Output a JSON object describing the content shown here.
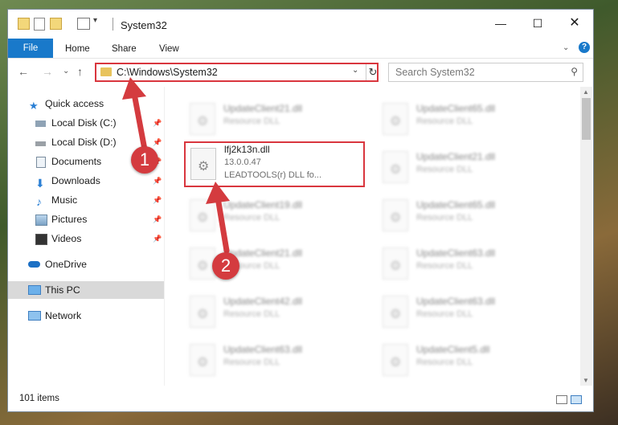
{
  "window": {
    "title": "System32"
  },
  "ribbon": {
    "tabs": [
      "File",
      "Home",
      "Share",
      "View"
    ]
  },
  "address": {
    "path": "C:\\Windows\\System32"
  },
  "search": {
    "placeholder": "Search System32"
  },
  "nav": {
    "quick_access": "Quick access",
    "local_c": "Local Disk (C:)",
    "local_d": "Local Disk (D:)",
    "documents": "Documents",
    "downloads": "Downloads",
    "music": "Music",
    "pictures": "Pictures",
    "videos": "Videos",
    "onedrive": "OneDrive",
    "this_pc": "This PC",
    "network": "Network"
  },
  "files": {
    "left": [
      {
        "name": "UpdateClient21.dll",
        "type": "Resource DLL"
      },
      {
        "name": "lfj2k13n.dll",
        "version": "13.0.0.47",
        "desc": "LEADTOOLS(r) DLL fo..."
      },
      {
        "name": "UpdateClient19.dll",
        "type": "Resource DLL"
      },
      {
        "name": "UpdateClient21.dll",
        "type": "Resource DLL"
      },
      {
        "name": "UpdateClient42.dll",
        "type": "Resource DLL"
      },
      {
        "name": "UpdateClient63.dll",
        "type": "Resource DLL"
      }
    ],
    "right": [
      {
        "name": "UpdateClient65.dll",
        "type": "Resource DLL"
      },
      {
        "name": "UpdateClient21.dll",
        "type": "Resource DLL"
      },
      {
        "name": "UpdateClient65.dll",
        "type": "Resource DLL"
      },
      {
        "name": "UpdateClient63.dll",
        "type": "Resource DLL"
      },
      {
        "name": "UpdateClient63.dll",
        "type": "Resource DLL"
      },
      {
        "name": "UpdateClient5.dll",
        "type": "Resource DLL"
      }
    ]
  },
  "status": {
    "count": "101 items"
  },
  "callouts": {
    "one": "1",
    "two": "2"
  },
  "colors": {
    "accent": "#1979ca",
    "highlight": "#d9363e"
  }
}
